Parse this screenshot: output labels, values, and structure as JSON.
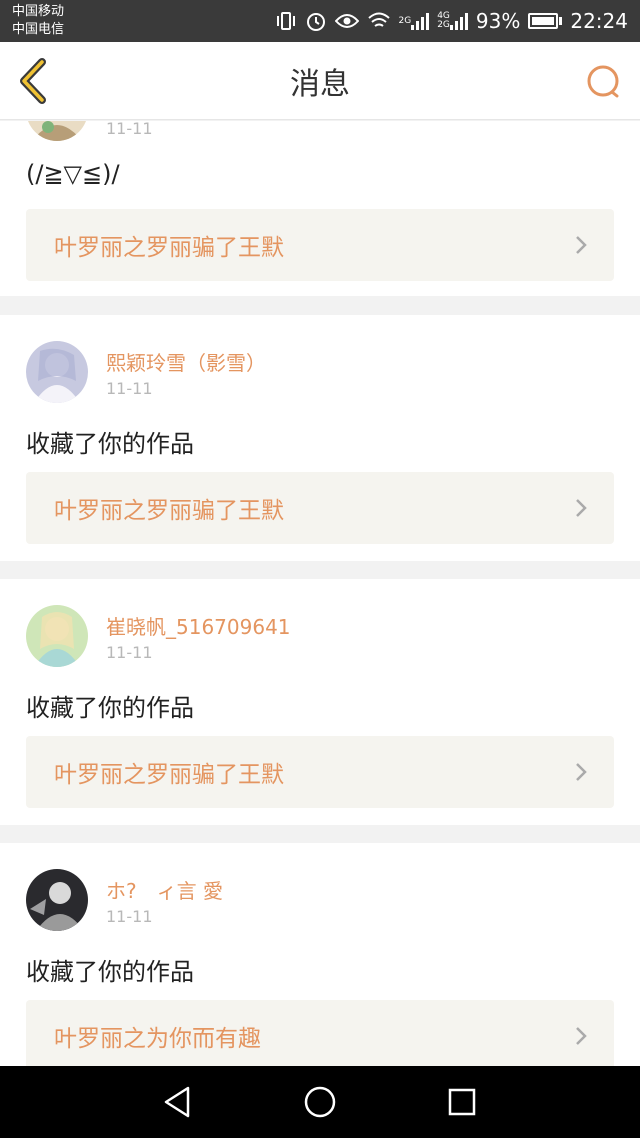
{
  "status_bar": {
    "carrier1": "中国移动",
    "carrier2": "中国电信",
    "net1": "2G",
    "net2a": "4G",
    "net2b": "2G",
    "battery": "93%",
    "time": "22:24"
  },
  "header": {
    "title": "消息"
  },
  "accent_color": "#e49560",
  "feed": [
    {
      "username": "",
      "date": "11-11",
      "message": "(/≧▽≦)/",
      "work_title": "叶罗丽之罗丽骗了王默"
    },
    {
      "username": "熙颖玲雪（影雪）",
      "date": "11-11",
      "message": "收藏了你的作品",
      "work_title": "叶罗丽之罗丽骗了王默"
    },
    {
      "username": "崔晓帆_516709641",
      "date": "11-11",
      "message": "收藏了你的作品",
      "work_title": "叶罗丽之罗丽骗了王默"
    },
    {
      "username": "ホ?　ィ言 愛",
      "date": "11-11",
      "message": "收藏了你的作品",
      "work_title": "叶罗丽之为你而有趣"
    }
  ]
}
